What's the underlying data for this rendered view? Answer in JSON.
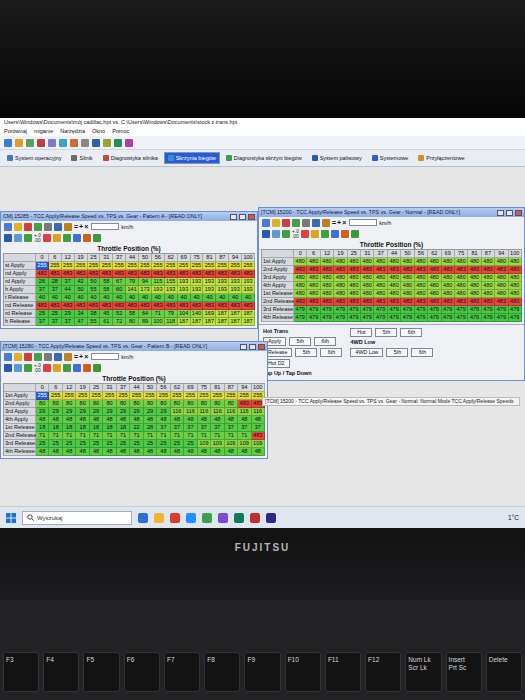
{
  "app": {
    "title": "Users\\Windows\\Documents\\mój cadillac.hpt vs. C:\\Users\\Windows\\Documents\\stock z trans.hpt",
    "menu": [
      "Porównaj",
      "miganie",
      "Narzędzia",
      "Okno",
      "Pomoc"
    ],
    "tabs": [
      {
        "label": "System operacyjny",
        "selected": false
      },
      {
        "label": "Silnik",
        "selected": false
      },
      {
        "label": "Diagnostyka silnika",
        "selected": false
      },
      {
        "label": "Skrzynia biegów",
        "selected": true
      },
      {
        "label": "Diagnostyka skrzyni biegów",
        "selected": false
      },
      {
        "label": "System paliwowy",
        "selected": false
      },
      {
        "label": "Systemowe",
        "selected": false
      },
      {
        "label": "Przyłączeniowe",
        "selected": false
      }
    ]
  },
  "windows": [
    {
      "title": "CM] 15285 - TCC Apply/Release Speed vs. TPS vs. Gear - Pattern A - [READ ONLY]",
      "symbols": "=+×",
      "decimals": [
        "+.0",
        ".00"
      ],
      "unit": "km/h",
      "axis_label": "Throttle Position (%)",
      "columns": [
        "0",
        "6",
        "12",
        "19",
        "25",
        "31",
        "37",
        "44",
        "50",
        "56",
        "62",
        "69",
        "75",
        "81",
        "87",
        "94",
        "100"
      ],
      "selected_cell": {
        "row": 0,
        "col": 0
      },
      "rows": [
        {
          "label": "st Apply",
          "cells": [
            "255",
            "255",
            "255",
            "255",
            "255",
            "255",
            "255",
            "255",
            "255",
            "255",
            "255",
            "255",
            "255",
            "255",
            "255",
            "255",
            "255"
          ]
        },
        {
          "label": "nd Apply",
          "cells": [
            "483",
            "483",
            "483",
            "483",
            "483",
            "483",
            "483",
            "483",
            "483",
            "483",
            "483",
            "483",
            "483",
            "483",
            "483",
            "483",
            "483"
          ]
        },
        {
          "label": "rd Apply",
          "cells": [
            "26",
            "28",
            "37",
            "42",
            "50",
            "58",
            "67",
            "79",
            "94",
            "115",
            "155",
            "193",
            "193",
            "193",
            "193",
            "193",
            "193"
          ]
        },
        {
          "label": "h Apply",
          "cells": [
            "37",
            "37",
            "44",
            "50",
            "55",
            "58",
            "60",
            "141",
            "173",
            "193",
            "193",
            "193",
            "193",
            "193",
            "193",
            "193",
            "193"
          ]
        },
        {
          "label": "t Release",
          "cells": [
            "40",
            "40",
            "40",
            "40",
            "40",
            "40",
            "40",
            "40",
            "40",
            "40",
            "40",
            "40",
            "40",
            "40",
            "40",
            "40",
            "40"
          ]
        },
        {
          "label": "nd Release",
          "cells": [
            "483",
            "483",
            "483",
            "483",
            "483",
            "483",
            "483",
            "483",
            "483",
            "483",
            "483",
            "483",
            "483",
            "483",
            "483",
            "483",
            "483"
          ]
        },
        {
          "label": "rd Release",
          "cells": [
            "25",
            "25",
            "29",
            "34",
            "38",
            "45",
            "52",
            "58",
            "64",
            "71",
            "79",
            "104",
            "140",
            "169",
            "187",
            "187",
            "187"
          ]
        },
        {
          "label": "h Release",
          "cells": [
            "37",
            "37",
            "37",
            "47",
            "55",
            "61",
            "72",
            "80",
            "89",
            "100",
            "118",
            "187",
            "187",
            "187",
            "187",
            "187",
            "187"
          ]
        }
      ]
    },
    {
      "title": "[TCM] 15200 - TCC Apply/Release Speed vs. TPS vs. Gear - Normal - [READ ONLY]",
      "symbols": "=+×",
      "decimals": [
        "+.0",
        ".00"
      ],
      "unit": "km/h",
      "axis_label": "Throttle Position (%)",
      "columns": [
        "0",
        "6",
        "12",
        "19",
        "25",
        "31",
        "37",
        "44",
        "50",
        "56",
        "62",
        "69",
        "75",
        "81",
        "87",
        "94",
        "100"
      ],
      "selected_cell": null,
      "rows": [
        {
          "label": "1st Apply",
          "cells": [
            "480",
            "480",
            "480",
            "480",
            "480",
            "480",
            "480",
            "480",
            "480",
            "480",
            "480",
            "480",
            "480",
            "480",
            "480",
            "480",
            "480"
          ]
        },
        {
          "label": "2nd Apply",
          "cells": [
            "483",
            "483",
            "483",
            "483",
            "483",
            "483",
            "483",
            "483",
            "483",
            "483",
            "483",
            "483",
            "483",
            "483",
            "483",
            "483",
            "483"
          ]
        },
        {
          "label": "3rd Apply",
          "cells": [
            "480",
            "480",
            "480",
            "480",
            "480",
            "480",
            "480",
            "480",
            "480",
            "480",
            "480",
            "480",
            "480",
            "480",
            "480",
            "480",
            "480"
          ]
        },
        {
          "label": "4th Apply",
          "cells": [
            "480",
            "480",
            "480",
            "480",
            "480",
            "480",
            "480",
            "480",
            "480",
            "480",
            "480",
            "480",
            "480",
            "480",
            "480",
            "480",
            "480"
          ]
        },
        {
          "label": "1st Release",
          "cells": [
            "480",
            "480",
            "480",
            "480",
            "480",
            "480",
            "480",
            "480",
            "480",
            "480",
            "480",
            "480",
            "480",
            "480",
            "480",
            "480",
            "480"
          ]
        },
        {
          "label": "2nd Release",
          "cells": [
            "483",
            "483",
            "483",
            "483",
            "483",
            "483",
            "483",
            "483",
            "483",
            "483",
            "483",
            "483",
            "483",
            "483",
            "483",
            "483",
            "483"
          ]
        },
        {
          "label": "3rd Release",
          "cells": [
            "479",
            "479",
            "479",
            "479",
            "479",
            "479",
            "479",
            "479",
            "479",
            "479",
            "479",
            "479",
            "479",
            "479",
            "479",
            "479",
            "479"
          ]
        },
        {
          "label": "4th Release",
          "cells": [
            "479",
            "479",
            "479",
            "479",
            "479",
            "479",
            "479",
            "479",
            "479",
            "479",
            "479",
            "479",
            "479",
            "479",
            "479",
            "479",
            "479"
          ]
        }
      ],
      "hot_panel": {
        "title": "Hot Trans",
        "left_rows": [
          [
            "Apply",
            "5th",
            "6th"
          ],
          [
            "Release",
            "5th",
            "6th"
          ],
          [
            "Hot D2"
          ]
        ],
        "footer": "Tap Up / Tap Down",
        "right_top": [
          "Hot",
          "5th",
          "6th"
        ],
        "right_title": "4WD Low",
        "right_bottom": [
          "4WD Low",
          "5th",
          "6th"
        ]
      }
    },
    {
      "title": "[TCM] 15280 - TCC Apply/Release Speed vs. TPS vs. Gear - Pattern B - [READ ONLY]",
      "symbols": "=+×",
      "decimals": [
        "+.0",
        ".00"
      ],
      "unit": "km/h",
      "axis_label": "Throttle Position (%)",
      "columns": [
        "0",
        "6",
        "12",
        "19",
        "25",
        "31",
        "37",
        "44",
        "50",
        "56",
        "62",
        "69",
        "75",
        "81",
        "87",
        "94",
        "100"
      ],
      "selected_cell": {
        "row": 0,
        "col": 0
      },
      "rows": [
        {
          "label": "1st Apply",
          "cells": [
            "255",
            "255",
            "255",
            "255",
            "255",
            "255",
            "255",
            "255",
            "255",
            "255",
            "255",
            "255",
            "255",
            "255",
            "255",
            "255",
            "255"
          ]
        },
        {
          "label": "2nd Apply",
          "cells": [
            "80",
            "80",
            "80",
            "80",
            "80",
            "80",
            "80",
            "80",
            "80",
            "80",
            "80",
            "80",
            "80",
            "80",
            "80",
            "483",
            "483"
          ]
        },
        {
          "label": "3rd Apply",
          "cells": [
            "29",
            "29",
            "29",
            "29",
            "29",
            "29",
            "29",
            "29",
            "29",
            "29",
            "116",
            "116",
            "116",
            "116",
            "116",
            "116",
            "116"
          ]
        },
        {
          "label": "4th Apply",
          "cells": [
            "48",
            "48",
            "48",
            "48",
            "48",
            "48",
            "48",
            "48",
            "48",
            "48",
            "48",
            "48",
            "48",
            "48",
            "48",
            "48",
            "48"
          ]
        },
        {
          "label": "1st Release",
          "cells": [
            "18",
            "18",
            "18",
            "18",
            "18",
            "18",
            "18",
            "22",
            "28",
            "37",
            "37",
            "37",
            "37",
            "37",
            "37",
            "37",
            "37"
          ]
        },
        {
          "label": "2nd Release",
          "cells": [
            "71",
            "71",
            "71",
            "71",
            "71",
            "71",
            "71",
            "71",
            "71",
            "71",
            "71",
            "71",
            "71",
            "71",
            "71",
            "71",
            "483"
          ]
        },
        {
          "label": "3rd Release",
          "cells": [
            "25",
            "25",
            "25",
            "25",
            "25",
            "25",
            "25",
            "25",
            "25",
            "25",
            "25",
            "25",
            "109",
            "109",
            "109",
            "109",
            "109"
          ]
        },
        {
          "label": "4th Release",
          "cells": [
            "48",
            "48",
            "48",
            "48",
            "48",
            "48",
            "48",
            "48",
            "48",
            "48",
            "48",
            "48",
            "48",
            "48",
            "48",
            "48",
            "48"
          ]
        }
      ]
    }
  ],
  "status_text": "[TCM] 15200 - TCC Apply/Release Speed vs. TPS vs. Gear - Normal: Normal Mode TCC Apply/Release Speeds",
  "taskbar": {
    "search": "Wyszukaj",
    "temperature": "1°C"
  },
  "laptop": {
    "brand": "FUJITSU",
    "keys": [
      {
        "label": "F3",
        "sub": ""
      },
      {
        "label": "F4",
        "sub": ""
      },
      {
        "label": "F5",
        "sub": ""
      },
      {
        "label": "F6",
        "sub": ""
      },
      {
        "label": "F7",
        "sub": ""
      },
      {
        "label": "F8",
        "sub": ""
      },
      {
        "label": "F9",
        "sub": ""
      },
      {
        "label": "F10",
        "sub": ""
      },
      {
        "label": "F11",
        "sub": ""
      },
      {
        "label": "F12",
        "sub": ""
      },
      {
        "label": "Num Lk",
        "sub": "Scr Lk"
      },
      {
        "label": "Insert",
        "sub": "Prt Sc"
      },
      {
        "label": "Delete",
        "sub": ""
      }
    ]
  }
}
